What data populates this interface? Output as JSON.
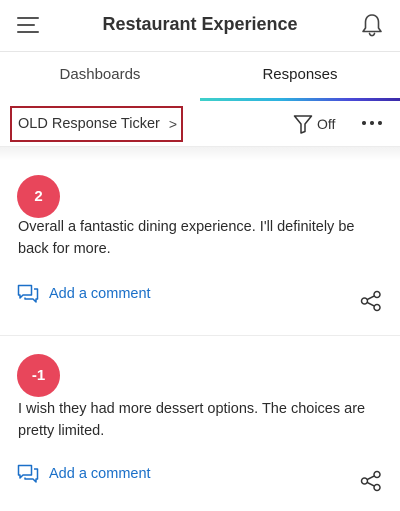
{
  "header": {
    "title": "Restaurant Experience",
    "menu_icon": "hamburger-menu-icon",
    "notification_icon": "bell-icon"
  },
  "tabs": [
    {
      "label": "Dashboards",
      "active": false
    },
    {
      "label": "Responses",
      "active": true
    }
  ],
  "toolbar": {
    "ticker_label": "OLD Response Ticker",
    "ticker_chevron": ">",
    "filter_status": "Off",
    "filter_icon": "funnel-icon",
    "more_icon": "more-horizontal-icon"
  },
  "responses": [
    {
      "score": "2",
      "text": "Overall a fantastic dining experience. I'll definitely be back for more.",
      "comment_label": "Add a comment"
    },
    {
      "score": "-1",
      "text": "I wish they had more dessert options. The choices are pretty limited.",
      "comment_label": "Add a comment"
    }
  ],
  "colors": {
    "score_badge": "#e8465b",
    "link": "#1a6fc8",
    "highlight_border": "#a8202d"
  }
}
